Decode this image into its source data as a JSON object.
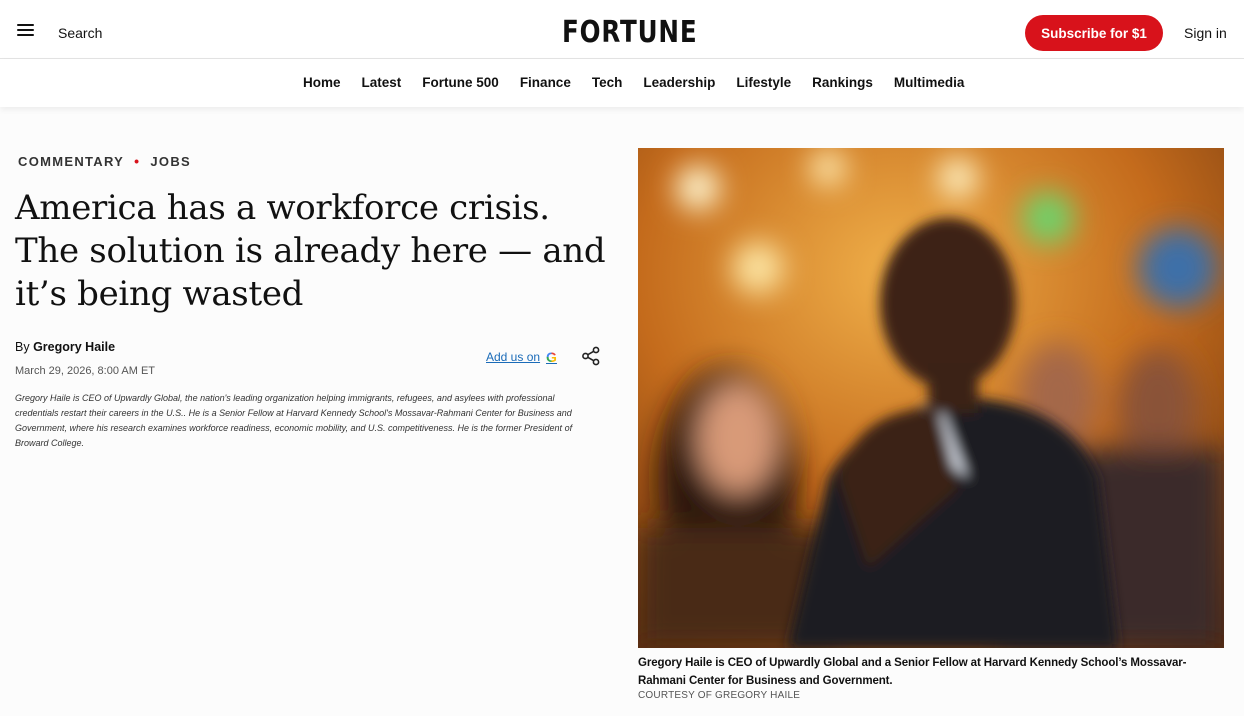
{
  "header": {
    "search_label": "Search",
    "logo_text": "FORTUNE",
    "subscribe_label": "Subscribe for $1",
    "signin_label": "Sign in"
  },
  "nav": {
    "items": [
      "Home",
      "Latest",
      "Fortune 500",
      "Finance",
      "Tech",
      "Leadership",
      "Lifestyle",
      "Rankings",
      "Multimedia"
    ]
  },
  "article": {
    "kicker": [
      "COMMENTARY",
      "JOBS"
    ],
    "headline": "America has a workforce crisis. The solution is already here — and it’s being wasted",
    "byline_prefix": "By",
    "author": "Gregory Haile",
    "date": "March 29, 2026, 8:00 AM ET",
    "add_us_label": "Add us on",
    "bio": "Gregory Haile is CEO of Upwardly Global, the nation's leading organization helping immigrants, refugees, and asylees with professional credentials restart their careers in the U.S.. He is a Senior Fellow at Harvard Kennedy School's Mossavar-Rahmani Center for Business and Government, where his research examines workforce readiness, economic mobility, and U.S. competitiveness. He is the former President of Broward College."
  },
  "image": {
    "caption": "Gregory Haile is CEO of Upwardly Global and a Senior Fellow at Harvard Kennedy School’s Mossavar-Rahmani Center for Business and Government.",
    "credit": "COURTESY OF GREGORY HAILE"
  },
  "colors": {
    "brand_red": "#d8121b",
    "link_blue": "#1a6bb8"
  }
}
